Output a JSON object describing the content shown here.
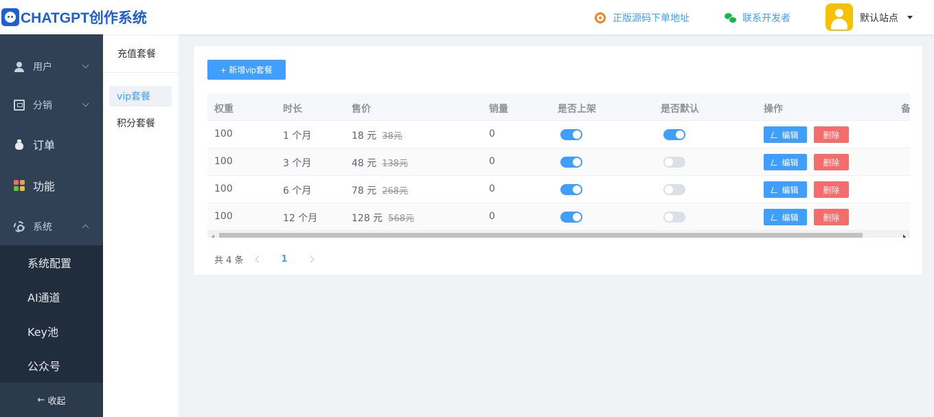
{
  "header": {
    "logo_text": "CHATGPT创作系统",
    "source_link": "正版源码下单地址",
    "contact_link": "联系开发者",
    "site_name": "默认站点"
  },
  "sidebar": {
    "items": [
      {
        "label": "用户"
      },
      {
        "label": "分销"
      },
      {
        "label": "订单"
      },
      {
        "label": "功能"
      },
      {
        "label": "系统"
      }
    ],
    "submenu": [
      {
        "label": "系统配置"
      },
      {
        "label": "AI通道"
      },
      {
        "label": "Key池"
      },
      {
        "label": "公众号"
      }
    ],
    "collapse_label": "收起"
  },
  "subnav": {
    "title": "充值套餐",
    "items": [
      {
        "label": "vip套餐"
      },
      {
        "label": "积分套餐"
      }
    ]
  },
  "main": {
    "add_button": "新增vip套餐",
    "columns": [
      "权重",
      "时长",
      "售价",
      "销量",
      "是否上架",
      "是否默认",
      "操作",
      "备"
    ],
    "rows": [
      {
        "weight": "100",
        "duration": "1 个月",
        "price": "18 元",
        "original": "38元",
        "sales": "0",
        "listed": true,
        "default": true
      },
      {
        "weight": "100",
        "duration": "3 个月",
        "price": "48 元",
        "original": "138元",
        "sales": "0",
        "listed": true,
        "default": false
      },
      {
        "weight": "100",
        "duration": "6 个月",
        "price": "78 元",
        "original": "268元",
        "sales": "0",
        "listed": true,
        "default": false
      },
      {
        "weight": "100",
        "duration": "12 个月",
        "price": "128 元",
        "original": "568元",
        "sales": "0",
        "listed": true,
        "default": false
      }
    ],
    "edit_label": "编辑",
    "delete_label": "删除",
    "pagination": {
      "total": "共 4 条",
      "current_page": "1"
    }
  },
  "colors": {
    "primary": "#409eff",
    "danger": "#f56c6c",
    "sidebar_bg": "#304156",
    "logo": "#1d5fd6"
  }
}
